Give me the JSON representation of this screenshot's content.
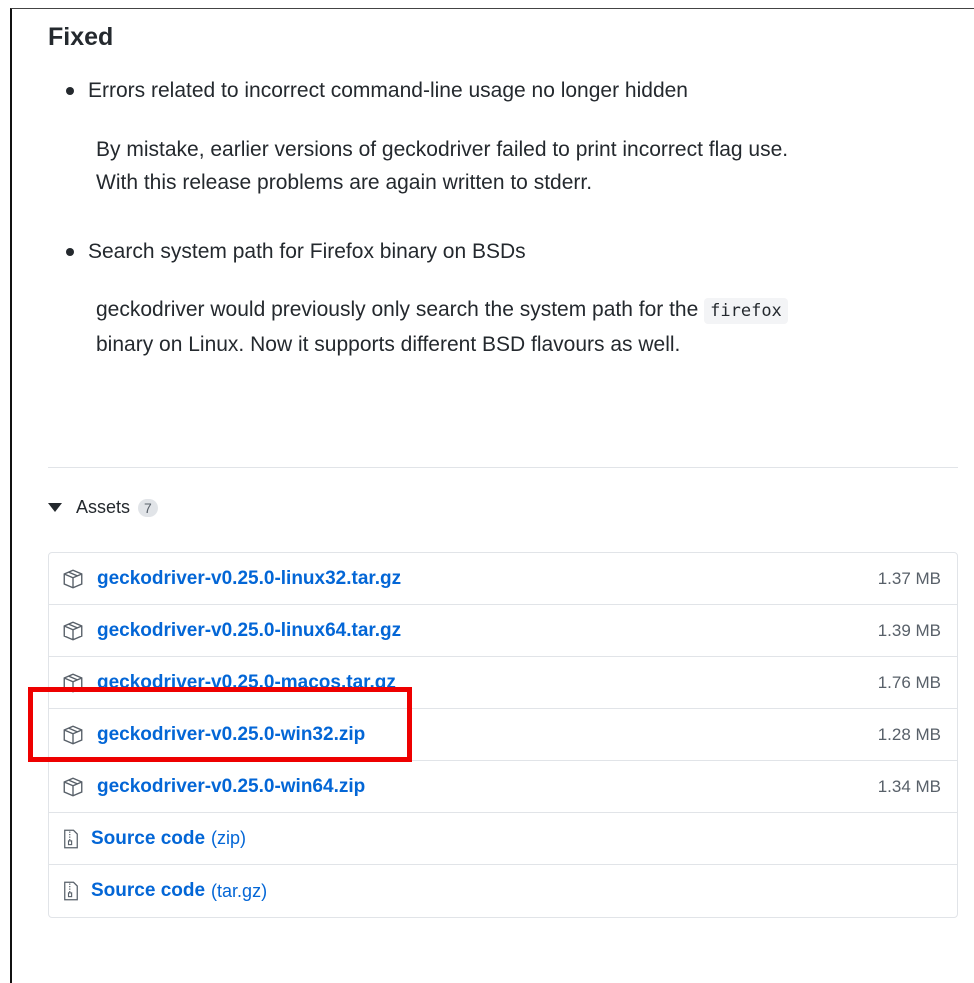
{
  "section": {
    "title": "Fixed",
    "items": [
      {
        "bullet": "Errors related to incorrect command-line usage no longer hidden",
        "paragraph": "By mistake, earlier versions of geckodriver failed to print incorrect flag use. With this release problems are again written to stderr."
      },
      {
        "bullet": "Search system path for Firefox binary on BSDs",
        "para_start": "geckodriver would previously only search the system path for the",
        "para_code": "firefox",
        "para_end": "binary on Linux. Now it supports different BSD flavours as well."
      }
    ]
  },
  "assets": {
    "label": "Assets",
    "count": "7",
    "items": [
      {
        "name": "geckodriver-v0.25.0-linux32.tar.gz",
        "size": "1.37 MB",
        "icon": "package-icon"
      },
      {
        "name": "geckodriver-v0.25.0-linux64.tar.gz",
        "size": "1.39 MB",
        "icon": "package-icon"
      },
      {
        "name": "geckodriver-v0.25.0-macos.tar.gz",
        "size": "1.76 MB",
        "icon": "package-icon"
      },
      {
        "name": "geckodriver-v0.25.0-win32.zip",
        "size": "1.28 MB",
        "icon": "package-icon"
      },
      {
        "name": "geckodriver-v0.25.0-win64.zip",
        "size": "1.34 MB",
        "icon": "package-icon"
      },
      {
        "name": "Source code",
        "suffix": "(zip)",
        "icon": "file-zip-icon"
      },
      {
        "name": "Source code",
        "suffix": "(tar.gz)",
        "icon": "file-zip-icon"
      }
    ]
  },
  "colors": {
    "link": "#0366d6",
    "highlight": "#ee0000"
  }
}
